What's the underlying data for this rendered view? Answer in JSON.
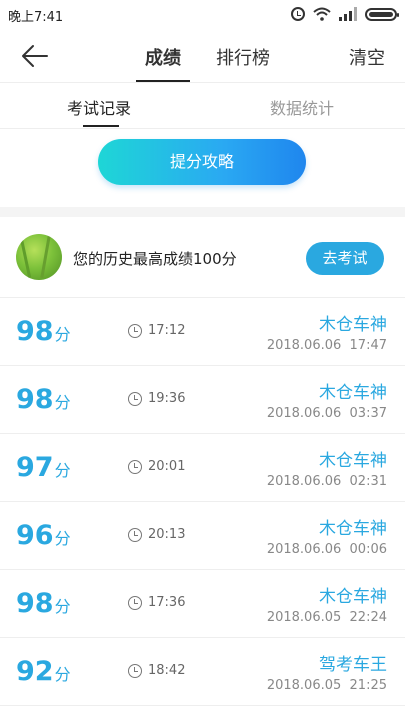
{
  "status_bar": {
    "time": "晚上7:41"
  },
  "header": {
    "tabs": [
      "成绩",
      "排行榜"
    ],
    "active_tab": "成绩",
    "clear_label": "清空"
  },
  "subtabs": {
    "active": "考试记录",
    "inactive": "数据统计"
  },
  "strategy_button": {
    "label": "提分攻略"
  },
  "best": {
    "text": "您的历史最高成绩100分",
    "button_label": "去考试"
  },
  "records": [
    {
      "score": "98",
      "unit": "分",
      "duration": "17:12",
      "title": "木仓车神",
      "date": "2018.06.06",
      "time": "17:47"
    },
    {
      "score": "98",
      "unit": "分",
      "duration": "19:36",
      "title": "木仓车神",
      "date": "2018.06.06",
      "time": "03:37"
    },
    {
      "score": "97",
      "unit": "分",
      "duration": "20:01",
      "title": "木仓车神",
      "date": "2018.06.06",
      "time": "02:31"
    },
    {
      "score": "96",
      "unit": "分",
      "duration": "20:13",
      "title": "木仓车神",
      "date": "2018.06.06",
      "time": "00:06"
    },
    {
      "score": "98",
      "unit": "分",
      "duration": "17:36",
      "title": "木仓车神",
      "date": "2018.06.05",
      "time": "22:24"
    },
    {
      "score": "92",
      "unit": "分",
      "duration": "18:42",
      "title": "驾考车王",
      "date": "2018.06.05",
      "time": "21:25"
    }
  ],
  "colors": {
    "accent": "#2aa8e0",
    "gradient_start": "#1ed6d6",
    "gradient_end": "#1f86ee"
  }
}
